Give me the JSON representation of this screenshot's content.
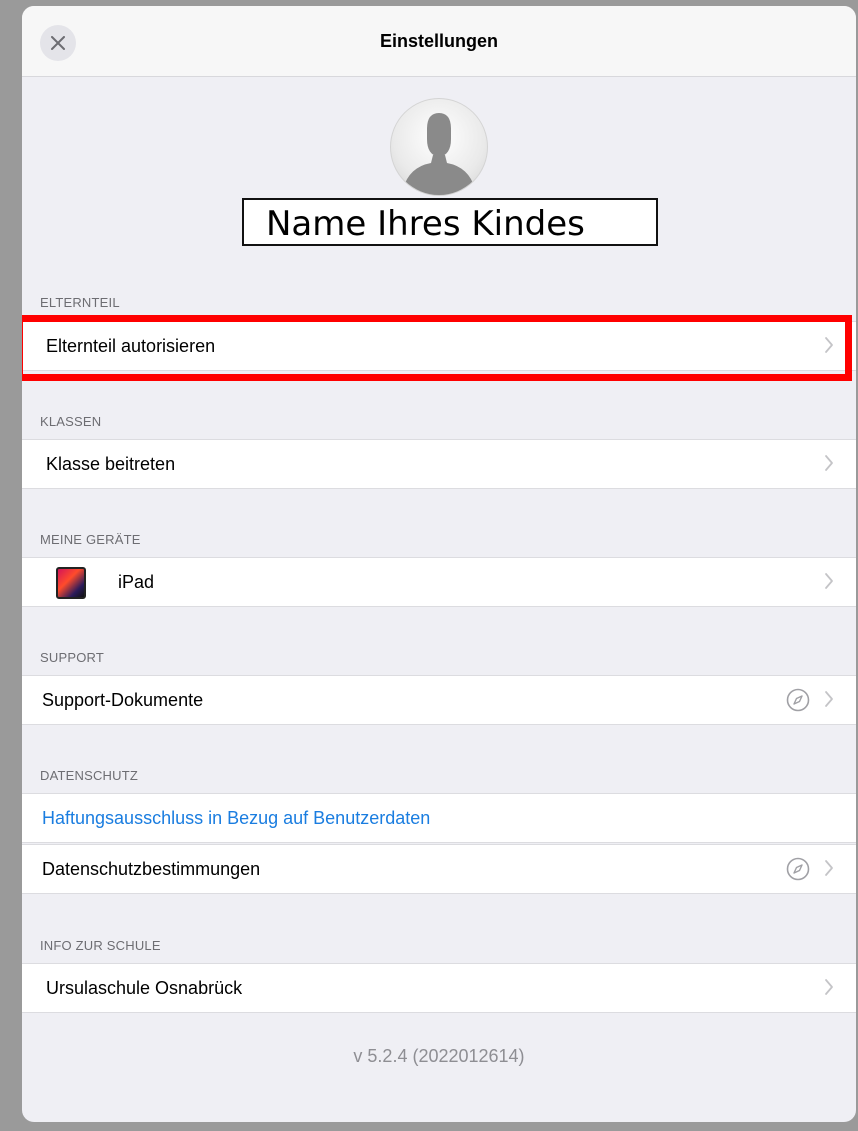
{
  "navbar": {
    "title": "Einstellungen",
    "close_icon": "close-icon"
  },
  "profile": {
    "avatar_icon": "person-silhouette-icon",
    "child_name": "Name Ihres Kindes"
  },
  "sections": {
    "elternteil": {
      "header": "ELTERNTEIL",
      "items": [
        {
          "label": "Elternteil autorisieren"
        }
      ]
    },
    "klassen": {
      "header": "KLASSEN",
      "items": [
        {
          "label": "Klasse beitreten"
        }
      ]
    },
    "geraete": {
      "header": "MEINE GERÄTE",
      "items": [
        {
          "label": "iPad",
          "icon": "ipad-icon"
        }
      ]
    },
    "support": {
      "header": "SUPPORT",
      "items": [
        {
          "label": "Support-Dokumente",
          "icon": "compass-icon"
        }
      ]
    },
    "datenschutz": {
      "header": "DATENSCHUTZ",
      "items": [
        {
          "label": "Haftungsausschluss in Bezug auf Benutzerdaten"
        },
        {
          "label": "Datenschutzbestimmungen",
          "icon": "compass-icon"
        }
      ]
    },
    "schule": {
      "header": "INFO ZUR SCHULE",
      "items": [
        {
          "label": "Ursulaschule Osnabrück"
        }
      ]
    }
  },
  "footer": {
    "version": "v 5.2.4 (2022012614)"
  },
  "colors": {
    "link": "#1a7de0",
    "highlight": "#ff0000",
    "background": "#efeff4"
  }
}
